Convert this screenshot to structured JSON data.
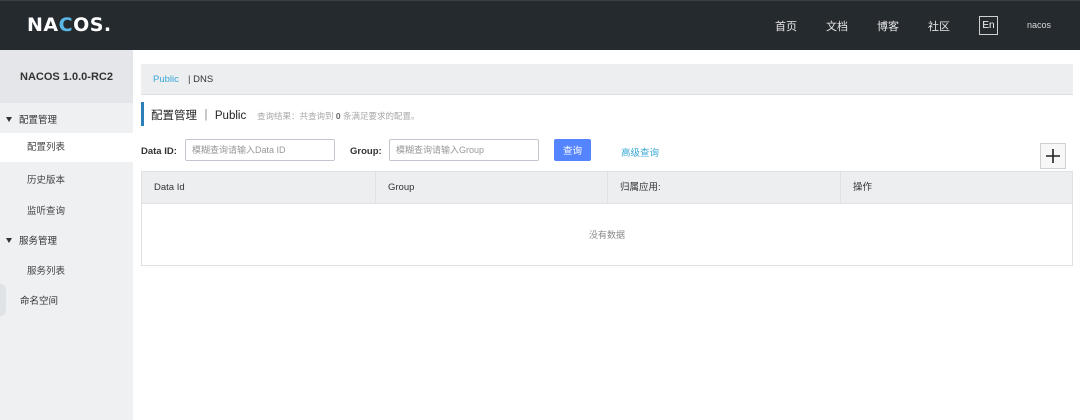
{
  "header": {
    "logo": {
      "pre": "NA",
      "c": "C",
      "post": "OS."
    },
    "nav": [
      "首页",
      "文档",
      "博客",
      "社区"
    ],
    "lang": "En",
    "user": "nacos"
  },
  "sidebar": {
    "title": "NACOS 1.0.0-RC2",
    "config_group": "配置管理",
    "config_items": [
      "配置列表",
      "历史版本",
      "监听查询"
    ],
    "service_group": "服务管理",
    "service_items": [
      "服务列表"
    ],
    "namespace": "命名空间"
  },
  "tabs": {
    "public": "Public",
    "dns": "| DNS"
  },
  "page": {
    "title": "配置管理 ｜ Public",
    "hint_prefix": "查询结果：共查询到",
    "hint_count": "0",
    "hint_suffix": "条满足要求的配置。"
  },
  "filters": {
    "dataid_label": "Data ID:",
    "dataid_placeholder": "模糊查询请输入Data ID",
    "group_label": "Group:",
    "group_placeholder": "模糊查询请输入Group",
    "query_button": "查询",
    "advanced_link": "高级查询"
  },
  "table": {
    "columns": [
      "Data Id",
      "Group",
      "归属应用:",
      "操作"
    ],
    "empty_text": "没有数据"
  },
  "colors": {
    "header_bg": "#252a2f",
    "accent": "#5584ff",
    "link": "#3aa8d8"
  }
}
